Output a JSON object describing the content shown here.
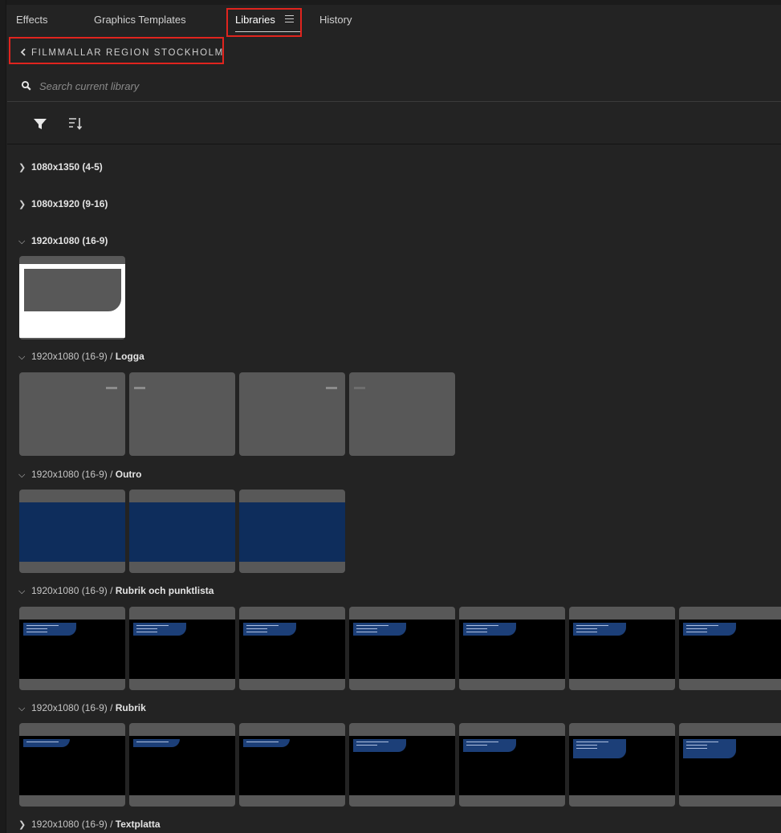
{
  "tabs": [
    {
      "label": "Effects"
    },
    {
      "label": "Graphics Templates"
    },
    {
      "label": "Libraries"
    },
    {
      "label": "History"
    }
  ],
  "active_tab": "Libraries",
  "breadcrumb": {
    "label": "FILMMALLAR REGION STOCKHOLM"
  },
  "search": {
    "placeholder": "Search current library",
    "value": ""
  },
  "toolbar": {
    "filter_icon": "filter-icon",
    "sort_icon": "sort-icon"
  },
  "folders": [
    {
      "prefix": "",
      "name": "1080x1350 (4-5)",
      "expanded": false
    },
    {
      "prefix": "",
      "name": "1080x1920 (9-16)",
      "expanded": false
    },
    {
      "prefix": "",
      "name": "1920x1080 (16-9)",
      "expanded": true,
      "thumb_count": 1
    },
    {
      "prefix": "1920x1080 (16-9) / ",
      "name": "Logga",
      "expanded": true,
      "thumb_count": 4
    },
    {
      "prefix": "1920x1080 (16-9) / ",
      "name": "Outro",
      "expanded": true,
      "thumb_count": 3
    },
    {
      "prefix": "1920x1080 (16-9) / ",
      "name": "Rubrik och punktlista",
      "expanded": true,
      "thumb_count": 7
    },
    {
      "prefix": "1920x1080 (16-9) / ",
      "name": "Rubrik",
      "expanded": true,
      "thumb_count": 7
    },
    {
      "prefix": "1920x1080 (16-9) / ",
      "name": "Textplatta",
      "expanded": false
    }
  ],
  "colors": {
    "highlight": "#e0241e",
    "panel_bg": "#232323",
    "thumb_gray": "#585858",
    "outro_blue": "#0e2d5c",
    "title_bubble": "#1c3f78"
  }
}
